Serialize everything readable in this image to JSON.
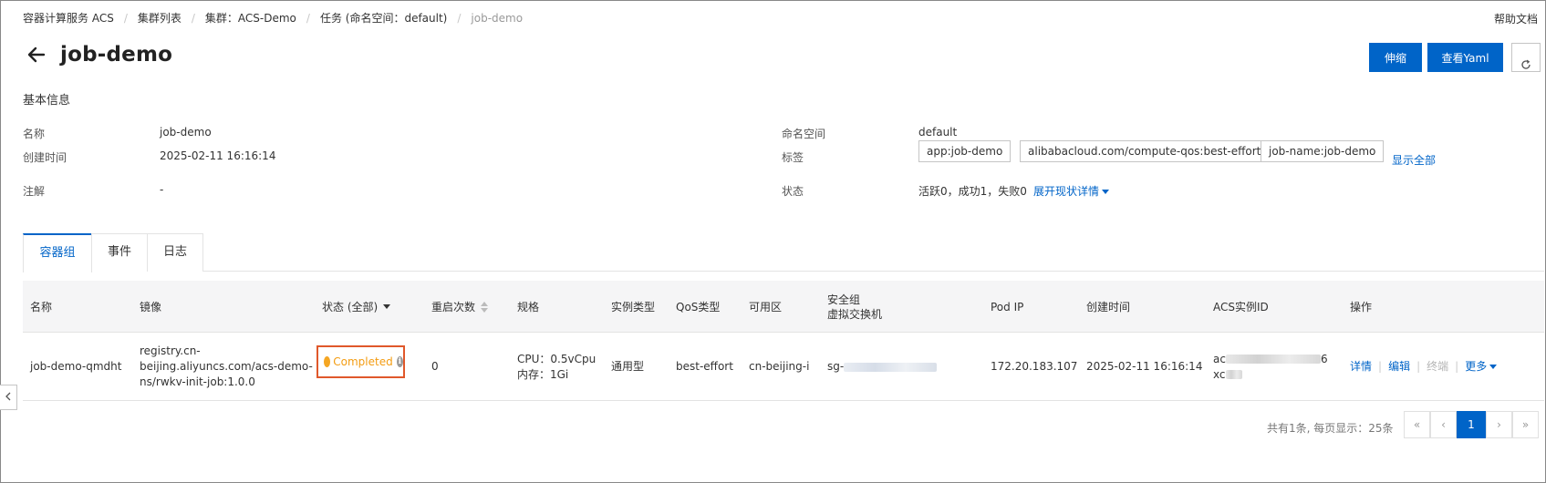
{
  "breadcrumb": {
    "items": [
      "容器计算服务 ACS",
      "集群列表",
      "集群：ACS-Demo",
      "任务 (命名空间：default)",
      "job-demo"
    ],
    "separator": "/"
  },
  "help_link": "帮助文档",
  "header": {
    "title": "job-demo",
    "scale_button": "伸缩",
    "yaml_button": "查看Yaml"
  },
  "basic_info": {
    "section_title": "基本信息",
    "name_label": "名称",
    "name_value": "job-demo",
    "created_label": "创建时间",
    "created_value": "2025-02-11 16:16:14",
    "annotation_label": "注解",
    "annotation_value": "-",
    "namespace_label": "命名空间",
    "namespace_value": "default",
    "labels_label": "标签",
    "labels": [
      "app:job-demo",
      "alibabacloud.com/compute-qos:best-effort",
      "job-name:job-demo"
    ],
    "show_all": "显示全部",
    "status_label": "状态",
    "status_value": "活跃0，成功1，失败0",
    "expand_status": "展开现状详情"
  },
  "tabs": [
    "容器组",
    "事件",
    "日志"
  ],
  "table": {
    "headers": {
      "name": "名称",
      "image": "镜像",
      "status": "状态 (全部)",
      "restarts": "重启次数",
      "spec": "规格",
      "instance_type": "实例类型",
      "qos": "QoS类型",
      "zone": "可用区",
      "security_group": "安全组",
      "vswitch": "虚拟交换机",
      "pod_ip": "Pod IP",
      "created": "创建时间",
      "acs_instance_id": "ACS实例ID",
      "actions": "操作"
    },
    "rows": [
      {
        "name": "job-demo-qmdht",
        "image_line1": "registry.cn-",
        "image_line2": "beijing.aliyuncs.com/acs-demo-",
        "image_line3": "ns/rwkv-init-job:1.0.0",
        "status": "Completed",
        "restarts": "0",
        "cpu": "CPU：0.5vCpu",
        "memory": "内存：1Gi",
        "instance_type": "通用型",
        "qos": "best-effort",
        "zone": "cn-beijing-i",
        "security_group_prefix": "sg-",
        "pod_ip": "172.20.183.107",
        "created": "2025-02-11 16:16:14",
        "acs_id_start": "ac",
        "acs_id_end": "6",
        "acs_id_line2": "xc",
        "action_detail": "详情",
        "action_edit": "编辑",
        "action_terminate": "终端",
        "action_more": "更多"
      }
    ]
  },
  "pagination": {
    "summary": "共有1条, 每页显示：25条",
    "first": "«",
    "prev": "‹",
    "current": "1",
    "next": "›",
    "last": "»"
  },
  "icons": {
    "back": "arrow-left-icon",
    "refresh": "refresh-icon",
    "status_info": "info-icon",
    "sort": "sort-icon",
    "collapse": "chevron-left-icon"
  },
  "colors": {
    "primary": "#0064c8",
    "status_completed": "#f5a623",
    "highlight_box": "#e0582b"
  }
}
